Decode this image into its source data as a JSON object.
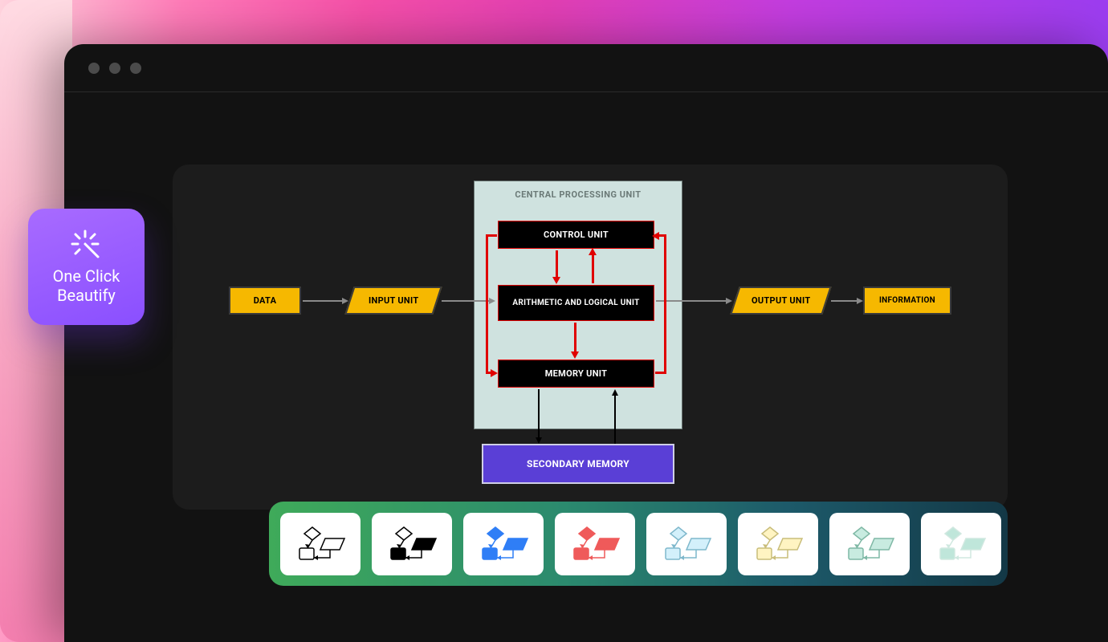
{
  "badge": {
    "line1": "One Click",
    "line2": "Beautify"
  },
  "diagram": {
    "cpu_title": "CENTRAL PROCESSING UNIT",
    "blocks": {
      "data": "DATA",
      "input": "INPUT UNIT",
      "control": "CONTROL UNIT",
      "alu": "ARITHMETIC AND LOGICAL UNIT",
      "memory": "MEMORY UNIT",
      "output": "OUTPUT UNIT",
      "information": "INFORMATION",
      "secondary": "SECONDARY MEMORY"
    },
    "flow": [
      [
        "DATA",
        "INPUT UNIT"
      ],
      [
        "INPUT UNIT",
        "CPU"
      ],
      [
        "CPU",
        "OUTPUT UNIT"
      ],
      [
        "OUTPUT UNIT",
        "INFORMATION"
      ],
      [
        "CONTROL UNIT",
        "ARITHMETIC AND LOGICAL UNIT",
        "bidirectional"
      ],
      [
        "ARITHMETIC AND LOGICAL UNIT",
        "MEMORY UNIT"
      ],
      [
        "CONTROL UNIT",
        "MEMORY UNIT",
        "bidirectional-loop"
      ],
      [
        "MEMORY UNIT",
        "SECONDARY MEMORY",
        "bidirectional"
      ]
    ]
  },
  "themes": [
    {
      "id": "outline-diamond",
      "fill": "none",
      "stroke": "#000"
    },
    {
      "id": "outline-filled",
      "fill": "#000",
      "stroke": "#000",
      "hollow": true
    },
    {
      "id": "blue",
      "fill": "#2f7ef6",
      "stroke": "#2f7ef6"
    },
    {
      "id": "red",
      "fill": "#ef5a5a",
      "stroke": "#ef5a5a"
    },
    {
      "id": "light-blue",
      "fill": "#d3f0fb",
      "stroke": "#7fb8cc"
    },
    {
      "id": "yellow",
      "fill": "#fff4c2",
      "stroke": "#c9bd7a"
    },
    {
      "id": "mint",
      "fill": "#c8ebe0",
      "stroke": "#7fb8a5"
    },
    {
      "id": "teal-fade",
      "fill": "#bfe6da",
      "stroke": "#d0e8e0"
    }
  ]
}
